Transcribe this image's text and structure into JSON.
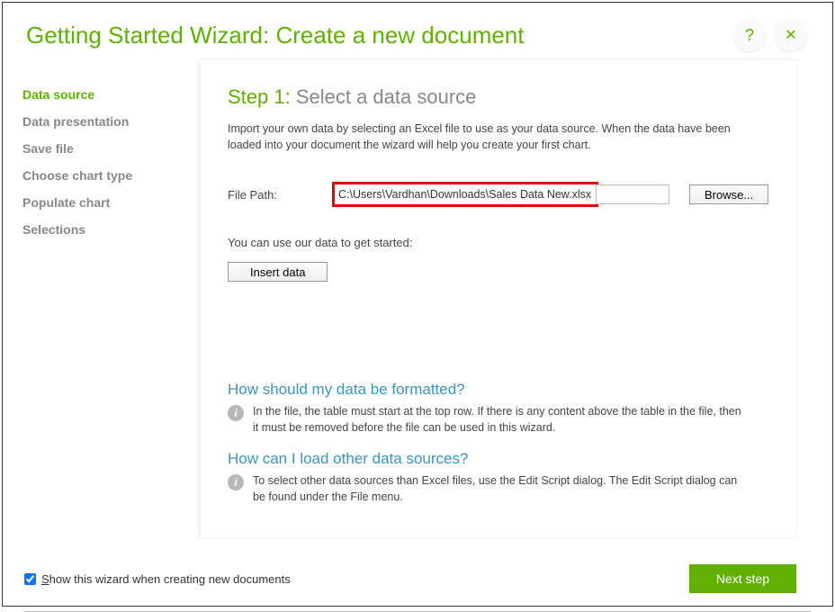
{
  "header": {
    "title": "Getting Started Wizard: Create a new document",
    "help_symbol": "?",
    "close_symbol": "✕"
  },
  "sidebar": {
    "items": [
      {
        "label": "Data source",
        "active": true
      },
      {
        "label": "Data presentation",
        "active": false
      },
      {
        "label": "Save file",
        "active": false
      },
      {
        "label": "Choose chart type",
        "active": false
      },
      {
        "label": "Populate chart",
        "active": false
      },
      {
        "label": "Selections",
        "active": false
      }
    ]
  },
  "content": {
    "step_number": "Step 1:",
    "step_title": "  Select a data source",
    "intro": "Import your own data by selecting an Excel file to use as your data source. When the data have been loaded into your document the wizard will help you create your first chart.",
    "file_path_label": "File Path:",
    "file_path_value": "C:\\Users\\Vardhan\\Downloads\\Sales Data New.xlsx",
    "browse_label": "Browse...",
    "use_our_data": "You can use our data to get started:",
    "insert_label": "Insert data",
    "help1_heading": "How should my data be formatted?",
    "help1_text": "In the file, the table must start at the top row. If there is any content above the table in the file, then it must be removed before the file can be used in this wizard.",
    "help2_heading": "How can I load other data sources?",
    "help2_text": "To select other data sources than Excel files, use the Edit Script dialog. The Edit Script dialog can be found under the File menu.",
    "info_symbol": "i"
  },
  "footer": {
    "checkbox_checked": true,
    "checkbox_label_pre": "S",
    "checkbox_label_rest": "how this wizard when creating new documents",
    "next_label": "Next step"
  }
}
